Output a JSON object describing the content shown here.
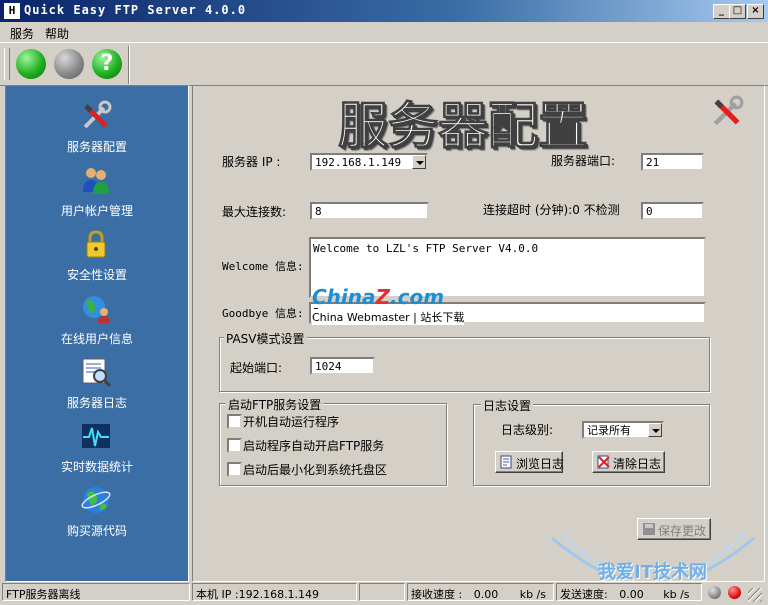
{
  "window": {
    "title": "Quick Easy FTP Server 4.0.0",
    "icon_text": "H"
  },
  "menu": {
    "items": [
      "服务",
      "帮助"
    ]
  },
  "toolbar": {
    "buttons": [
      {
        "name": "start-server",
        "color": "#22b022"
      },
      {
        "name": "stop-server",
        "color": "#8a8a8a"
      },
      {
        "name": "help",
        "color": "#22b022",
        "glyph": "?"
      }
    ]
  },
  "sidebar": {
    "items": [
      {
        "icon": "tools-icon",
        "label": "服务器配置"
      },
      {
        "icon": "users-icon",
        "label": "用户帐户管理"
      },
      {
        "icon": "lock-icon",
        "label": "安全性设置"
      },
      {
        "icon": "globe-users-icon",
        "label": "在线用户信息"
      },
      {
        "icon": "log-search-icon",
        "label": "服务器日志"
      },
      {
        "icon": "pulse-icon",
        "label": "实时数据统计"
      },
      {
        "icon": "globe-icon",
        "label": "购买源代码"
      }
    ]
  },
  "main": {
    "title": "服务器配置",
    "server_ip_label": "服务器 IP :",
    "server_ip_value": "192.168.1.149",
    "port_label": "服务器端口:",
    "port_value": "21",
    "max_conn_label": "最大连接数:",
    "max_conn_value": "8",
    "timeout_label": "连接超时 (分钟):0 不检测",
    "timeout_value": "0",
    "welcome_label": "Welcome 信息:",
    "welcome_value": "Welcome to LZL's FTP Server V4.0.0",
    "goodbye_label": "Goodbye 信息:",
    "goodbye_value": "Bye",
    "pasv": {
      "title": "PASV模式设置",
      "start_port_label": "起始端口:",
      "start_port_value": "1024"
    },
    "startup": {
      "title": "启动FTP服务设置",
      "options": [
        "开机自动运行程序",
        "启动程序自动开启FTP服务",
        "启动后最小化到系统托盘区"
      ]
    },
    "log": {
      "title": "日志设置",
      "level_label": "日志级别:",
      "level_value": "记录所有",
      "browse_label": "浏览日志",
      "clear_label": "清除日志"
    },
    "save_label": "保存更改"
  },
  "watermarks": {
    "china_z": "China",
    "china_z_z": "Z",
    "china_z_com": ".com",
    "china_sub": "China Webmaster | 站长下载",
    "site": "我爱IT技术网"
  },
  "statusbar": {
    "status": "FTP服务器离线",
    "local_ip": "本机 IP :192.168.1.149",
    "recv_label": "接收速度 :",
    "recv_value": "0.00",
    "recv_unit": "kb /s",
    "send_label": "发送速度:",
    "send_value": "0.00",
    "send_unit": "kb /s"
  },
  "colors": {
    "sidebar_bg": "#3a6ea5",
    "led_off": "#8a8a8a",
    "led_on": "#e01010"
  }
}
